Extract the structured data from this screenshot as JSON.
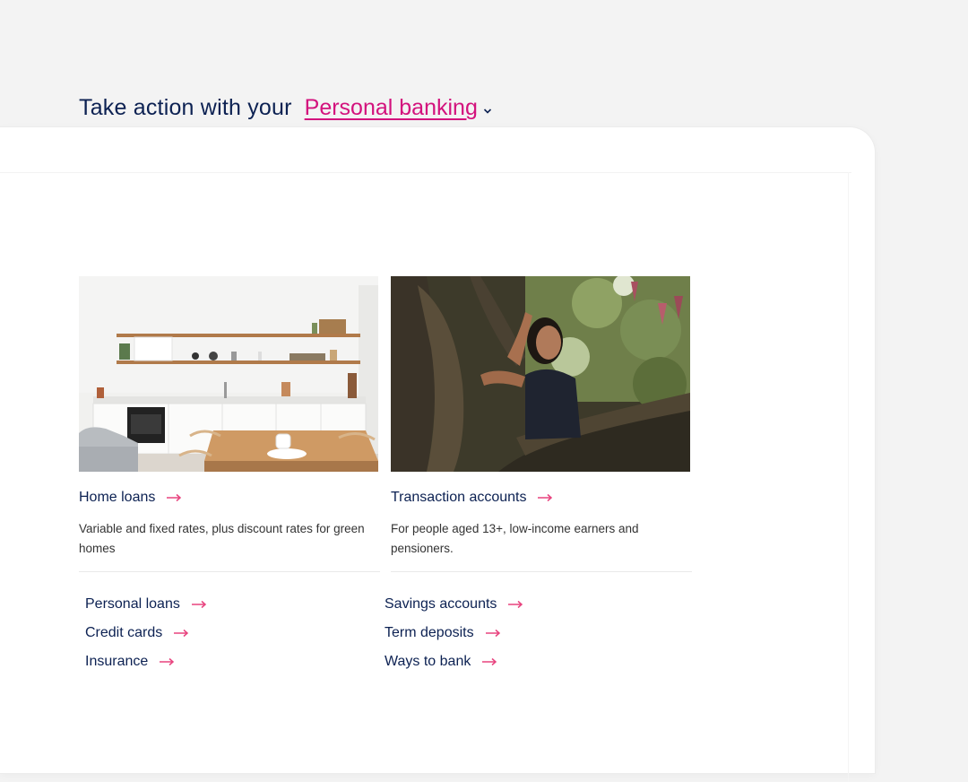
{
  "heading": {
    "prefix": "Take action with your",
    "segment_selected": "Personal banking"
  },
  "cards": [
    {
      "title": "Home loans",
      "description": "Variable and fixed rates, plus discount rates for green homes",
      "image": "kitchen-photo"
    },
    {
      "title": "Transaction accounts",
      "description": "For people aged 13+, low-income earners and pensioners.",
      "image": "girl-in-tree-photo"
    }
  ],
  "quick_links": {
    "left": [
      "Personal loans",
      "Credit cards",
      "Insurance"
    ],
    "right": [
      "Savings accounts",
      "Term deposits",
      "Ways to bank"
    ]
  },
  "colors": {
    "navy": "#0c2152",
    "accent_pink": "#d3127d",
    "arrow_pink": "#e8447f"
  },
  "icons": {
    "arrow": "arrow-right-icon",
    "chevron": "chevron-down-icon"
  }
}
